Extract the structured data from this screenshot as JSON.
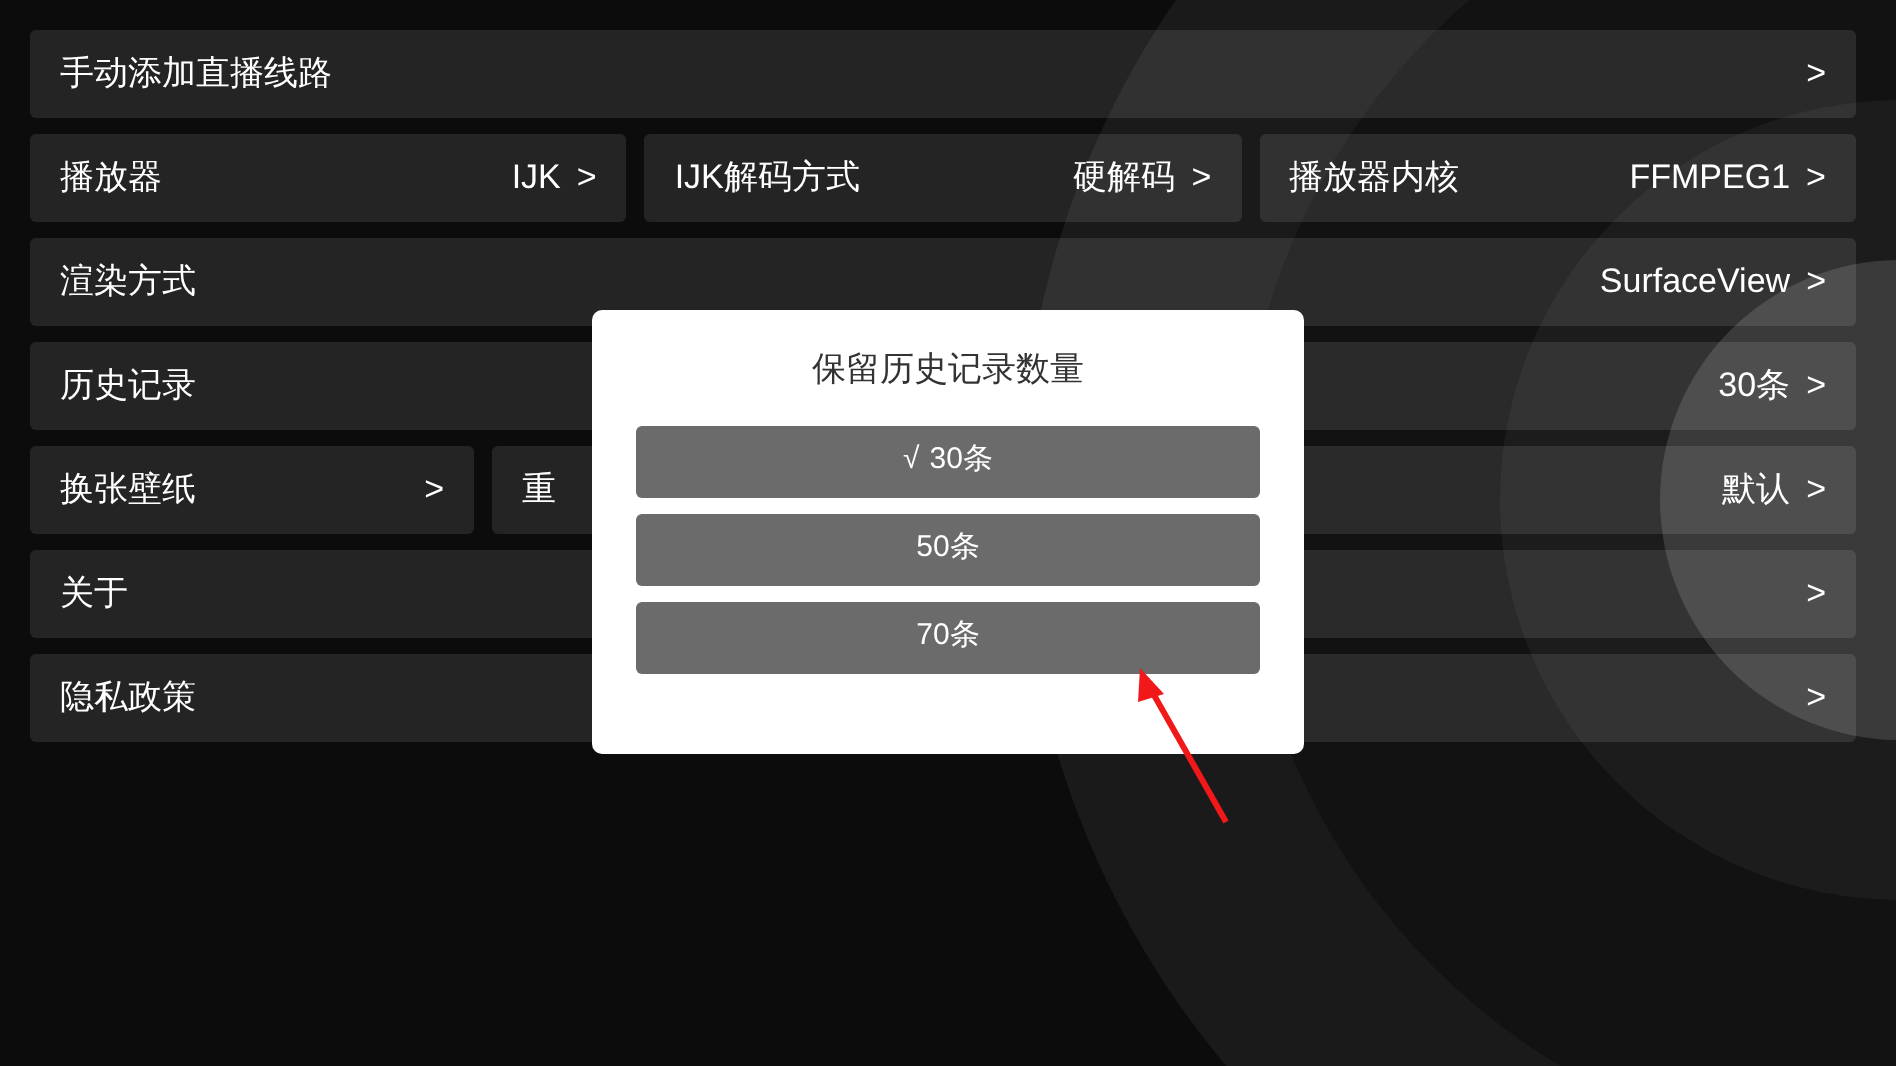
{
  "settings_rows": [
    [
      {
        "label": "手动添加直播线路",
        "arrow": ">"
      }
    ],
    [
      {
        "label": "播放器",
        "value": "IJK",
        "arrow": ">"
      },
      {
        "label": "IJK解码方式",
        "value": "硬解码",
        "arrow": ">"
      },
      {
        "label": "播放器内核",
        "value": "FFMPEG1",
        "arrow": ">"
      }
    ],
    [
      {
        "label": "渲染方式",
        "value": "SurfaceView",
        "arrow": ">"
      }
    ],
    [
      {
        "label": "历史记录",
        "value": "30条",
        "arrow": ">"
      }
    ],
    [
      {
        "label": "换张壁纸",
        "arrow": ">"
      },
      {
        "label": "重",
        "value": "默认",
        "arrow": ">"
      }
    ],
    [
      {
        "label": "关于",
        "arrow": ">"
      }
    ],
    [
      {
        "label": "隐私政策",
        "arrow": ">"
      }
    ]
  ],
  "dialog": {
    "title": "保留历史记录数量",
    "selected_mark": "√",
    "options": [
      {
        "label": "30条",
        "selected": true
      },
      {
        "label": "50条",
        "selected": false
      },
      {
        "label": "70条",
        "selected": false
      }
    ]
  }
}
